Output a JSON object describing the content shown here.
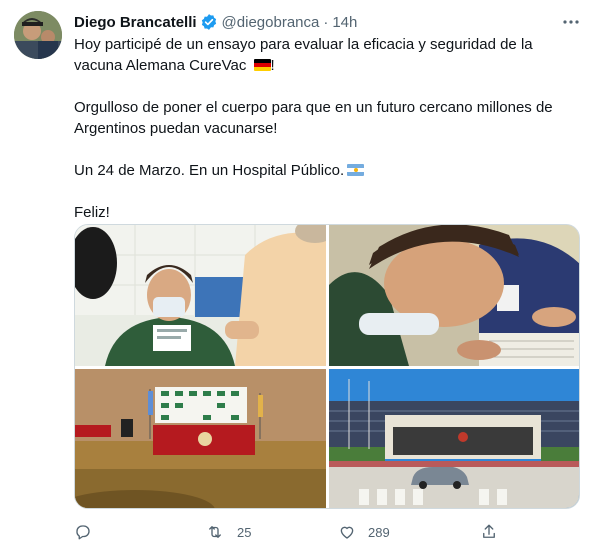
{
  "tweet": {
    "display_name": "Diego Brancatelli",
    "handle": "@diegobranca",
    "separator": "·",
    "time": "14h",
    "paragraph_1": "Hoy participé de un ensayo para evaluar la eficacia y seguridad de la vacuna Alemana CureVac",
    "paragraph_1_end": "!",
    "paragraph_2": "Orgulloso de poner el cuerpo para que en un futuro cercano millones de Argentinos puedan vacunarse!",
    "paragraph_3": "Un 24 de Marzo. En un Hospital Público.",
    "paragraph_4": "Feliz!"
  },
  "actions": {
    "retweets": "25",
    "likes": "289"
  },
  "icons": {
    "verified": "verified-badge-icon",
    "more": "more-icon",
    "reply": "reply-icon",
    "retweet": "retweet-icon",
    "like": "heart-icon",
    "share": "share-icon",
    "flag_germany": "germany-flag-icon",
    "flag_argentina": "argentina-flag-icon"
  },
  "colors": {
    "accent": "#1d9bf0",
    "muted": "#536471",
    "text": "#0f1419"
  }
}
